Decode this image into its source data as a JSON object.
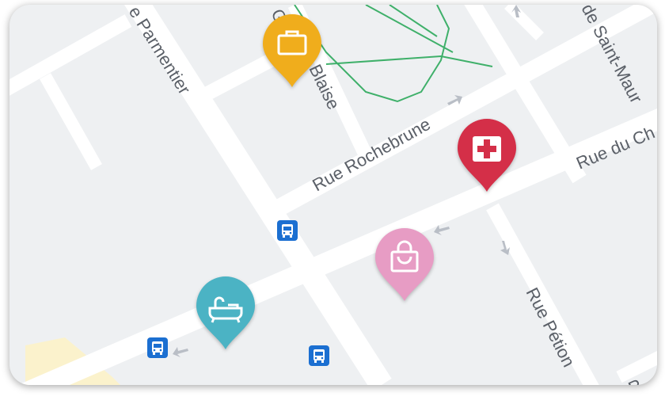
{
  "streets": {
    "parmentier": "e Parmentier",
    "blaise": "Blaise",
    "blaise_prefix": "G",
    "rochebrune": "Rue Rochebrune",
    "saint_maur": "de Saint-Maur",
    "chemin": "Rue du Ch",
    "petion": "Rue Pétion",
    "corner": "R"
  },
  "pois": {
    "work": {
      "icon": "briefcase-icon",
      "color": "#f0ad1c"
    },
    "medical": {
      "icon": "medical-cross-icon",
      "color": "#d42f48"
    },
    "shopping": {
      "icon": "shopping-bag-icon",
      "color": "#e79cc4"
    },
    "bath": {
      "icon": "bathtub-icon",
      "color": "#4bb3c4"
    }
  },
  "bus_stops": {
    "icon": "bus-icon",
    "color": "#1b6fd1",
    "count": 3
  },
  "colors": {
    "map_bg": "#eef0f2",
    "road": "#ffffff",
    "park_path": "#3fb06a",
    "sand": "#fbf2cc",
    "label": "#5b6068"
  }
}
